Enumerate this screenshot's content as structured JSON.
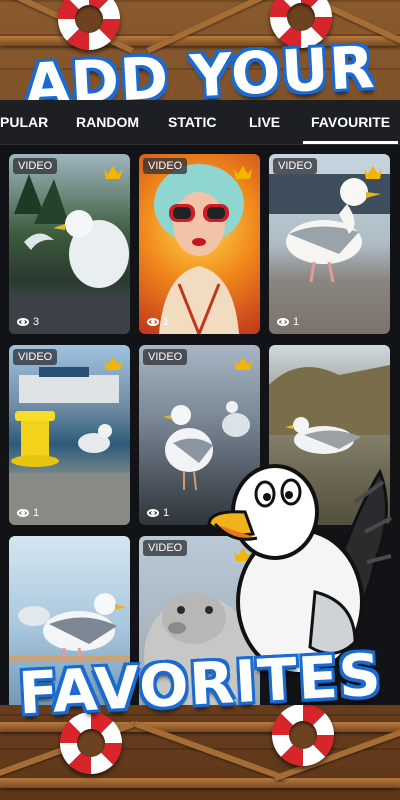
{
  "promo": {
    "headline_top": "ADD YOUR",
    "headline_bottom": "FAVORITES"
  },
  "tabs": [
    {
      "label": "PULAR",
      "active": false
    },
    {
      "label": "RANDOM",
      "active": false
    },
    {
      "label": "STATIC",
      "active": false
    },
    {
      "label": "LIVE",
      "active": false
    },
    {
      "label": "FAVOURITE",
      "active": true
    }
  ],
  "wallpapers": [
    {
      "badge": "VIDEO",
      "premium": true,
      "views": "3",
      "subject": "seagull-coast"
    },
    {
      "badge": "VIDEO",
      "premium": true,
      "views": "1",
      "subject": "girl-sunglasses"
    },
    {
      "badge": "VIDEO",
      "premium": true,
      "views": "1",
      "subject": "seagull-dock"
    },
    {
      "badge": "VIDEO",
      "premium": true,
      "views": "1",
      "subject": "harbor-bollard"
    },
    {
      "badge": "VIDEO",
      "premium": true,
      "views": "1",
      "subject": "seagulls-shore"
    },
    {
      "badge": "",
      "premium": false,
      "views": "",
      "subject": "seagull-rocks"
    },
    {
      "badge": "",
      "premium": false,
      "views": "",
      "subject": "seagulls-railing"
    },
    {
      "badge": "VIDEO",
      "premium": true,
      "views": "",
      "subject": "seal-face"
    }
  ],
  "colors": {
    "accent_blue": "#1a6ad0",
    "crown_gold": "#f4b400",
    "tabbar_bg": "#1e1f23",
    "grid_bg": "#121316"
  }
}
